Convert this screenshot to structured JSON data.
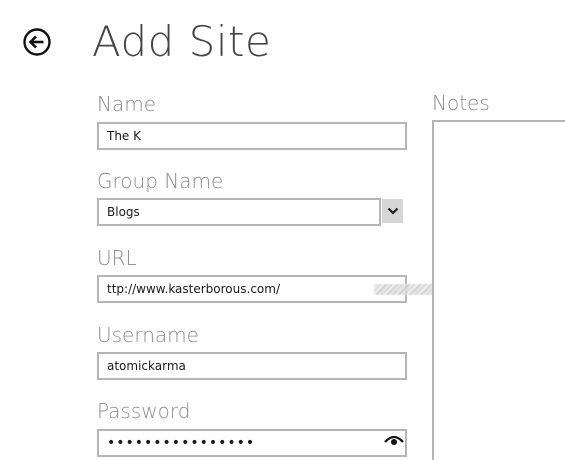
{
  "header": {
    "title": "Add Site",
    "back_icon": "back-arrow-icon"
  },
  "form": {
    "name": {
      "label": "Name",
      "value": "The K"
    },
    "group_name": {
      "label": "Group Name",
      "value": "Blogs",
      "dropdown_icon": "chevron-down-icon"
    },
    "url": {
      "label": "URL",
      "value": "ttp://www.kasterborous.com/"
    },
    "username": {
      "label": "Username",
      "value": "atomickarma"
    },
    "password": {
      "label": "Password",
      "value": "••••••••••••••••",
      "reveal_icon": "eye-icon"
    }
  },
  "notes": {
    "label": "Notes",
    "value": ""
  },
  "colors": {
    "border": "#b5b5b5",
    "label": "#8a8a8a",
    "title": "#444444",
    "chevron_bg": "#d6d6d6"
  }
}
